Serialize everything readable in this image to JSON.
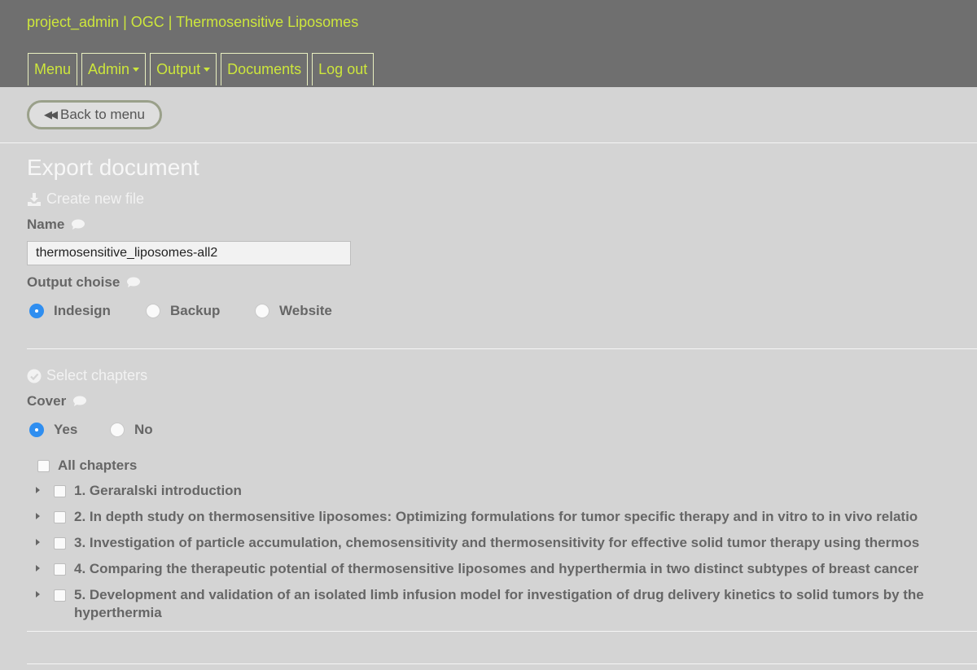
{
  "header": {
    "title": "project_admin | OGC | Thermosensitive Liposomes",
    "nav": [
      {
        "label": "Menu",
        "dropdown": false
      },
      {
        "label": "Admin",
        "dropdown": true
      },
      {
        "label": "Output",
        "dropdown": true
      },
      {
        "label": "Documents",
        "dropdown": false
      },
      {
        "label": "Log out",
        "dropdown": false
      }
    ]
  },
  "back_label": "Back to menu",
  "page_title": "Export document",
  "create_section": {
    "heading": "Create new file",
    "name_label": "Name",
    "name_value": "thermosensitive_liposomes-all2",
    "output_label": "Output choise",
    "output_options": [
      "Indesign",
      "Backup",
      "Website"
    ],
    "output_selected": "Indesign"
  },
  "chapters_section": {
    "heading": "Select chapters",
    "cover_label": "Cover",
    "cover_options": [
      "Yes",
      "No"
    ],
    "cover_selected": "Yes",
    "all_label": "All chapters",
    "chapters": [
      "1. Geraralski introduction",
      "2. In depth study on thermosensitive liposomes: Optimizing formulations for tumor specific therapy and in vitro to in vivo relatio",
      "3. Investigation of particle accumulation, chemosensitivity and thermosensitivity for effective solid tumor therapy using thermos",
      "4. Comparing the therapeutic potential of thermosensitive liposomes and hyperthermia in two distinct subtypes of breast cancer",
      "5. Development and validation of an isolated limb infusion model for investigation of drug delivery kinetics to solid tumors by the hyperthermia"
    ]
  },
  "colors": {
    "header_bg": "#6f6f6f",
    "accent": "#cde63c",
    "radio_selected": "#2f8ef0"
  }
}
